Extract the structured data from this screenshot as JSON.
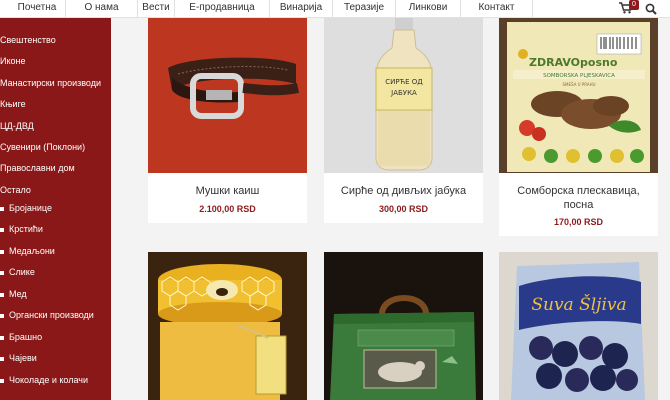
{
  "nav": {
    "items": [
      "Почетна",
      "О нама",
      "Вести",
      "Е-продавница",
      "Винарија",
      "Теразије",
      "Линкови",
      "Контакт"
    ],
    "cart_count": "0",
    "cart_icon": "cart-icon",
    "search_icon": "search-icon"
  },
  "sidebar": {
    "categories": [
      "Свештенство",
      "Иконе",
      "Манастирски производи",
      "Књиге",
      "ЦД-ДВД",
      "Сувенири (Поклони)",
      "Православни дом",
      "Остало"
    ],
    "subcategories": [
      "Бројанице",
      "Крстићи",
      "Медаљони",
      "Слике",
      "Мед",
      "Органски производи",
      "Брашно",
      "Чајеви",
      "Чоколаде и колачи"
    ]
  },
  "products": [
    {
      "name": "Мушки каиш",
      "price": "2.100,00 RSD"
    },
    {
      "name": "Сирће од дивљих јабука",
      "price": "300,00 RSD",
      "label_line1": "СИРЋЕ ОД",
      "label_line2": "ЈАБУКА"
    },
    {
      "name": "Сомборска плескавица, посна",
      "name_line1": "Сомборска плескавица,",
      "name_line2": "посна",
      "price": "170,00 RSD",
      "brand": "ZDRAVOposno",
      "pack_label": "SOMBORSKA PLJESKAVICA",
      "pack_sub": "SMEŠA U PRAHU"
    },
    {
      "name": "Мед",
      "price": ""
    },
    {
      "name": "",
      "price": ""
    },
    {
      "name": "Suva Šljiva",
      "price": "",
      "pack_label": "Suva Šljiva"
    }
  ]
}
